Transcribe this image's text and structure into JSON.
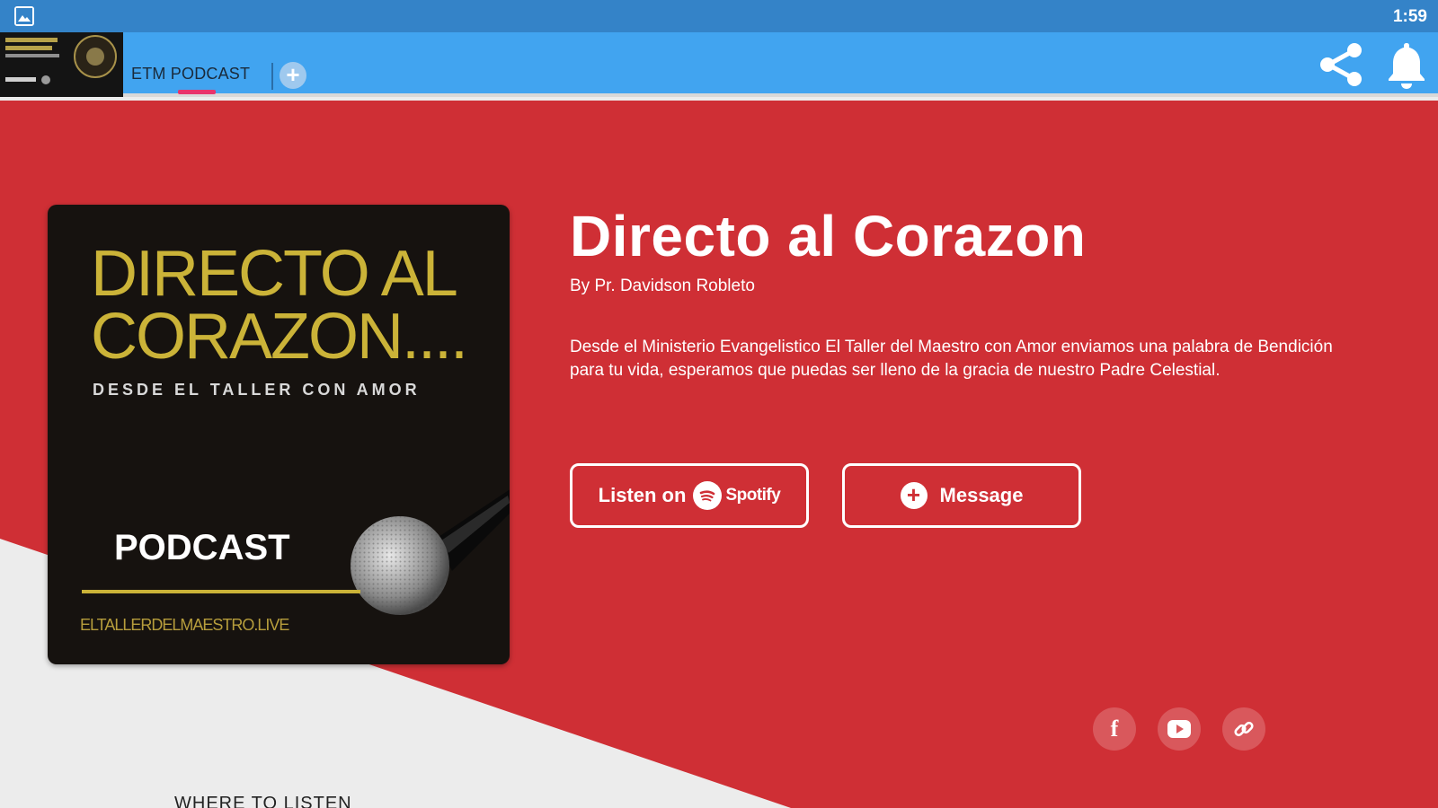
{
  "status_bar": {
    "time": "1:59",
    "icons": [
      "image-notification-icon"
    ]
  },
  "app_bar": {
    "logo_icon": "app-logo",
    "tabs": [
      {
        "label": "ETM PODCAST",
        "active": true
      }
    ],
    "add_tab_glyph": "+",
    "actions": [
      "share-icon",
      "bell-icon"
    ],
    "bar_color": "#41a4f0",
    "status_color": "#3483c8",
    "tab_indicator_color": "#e8336b"
  },
  "podcast": {
    "cover": {
      "title": "DIRECTO AL\nCORAZON....",
      "subtitle": "DESDE EL TALLER CON AMOR",
      "badge": "PODCAST",
      "url": "ELTALLERDELMAESTRO.LIVE",
      "title_color": "#cbb338",
      "background": "#16120f"
    },
    "title": "Directo al Corazon",
    "author": "By Pr. Davidson Robleto",
    "description": "Desde el Ministerio Evangelistico El Taller del Maestro con Amor enviamos una palabra de Bendición para tu vida, esperamos que puedas ser lleno de la gracia de nuestro Padre Celestial.",
    "accent_color": "#cf2f35"
  },
  "buttons": {
    "listen_label": "Listen on",
    "spotify_label": "Spotify",
    "message_label": "Message"
  },
  "social": {
    "facebook_glyph": "f",
    "icons": [
      "facebook-icon",
      "youtube-icon",
      "link-icon"
    ]
  },
  "sections": {
    "where_to_listen": "WHERE TO LISTEN"
  }
}
